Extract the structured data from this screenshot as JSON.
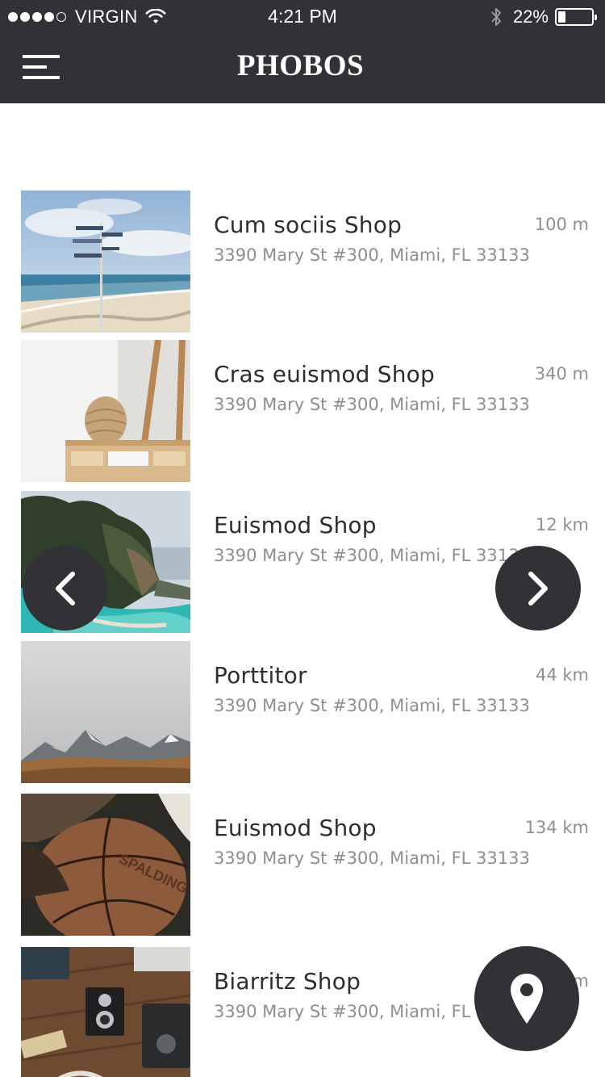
{
  "status_bar": {
    "carrier": "VIRGIN",
    "time": "4:21 PM",
    "battery_percent": "22%",
    "battery_level": 0.22,
    "signal_bars_filled": 4,
    "signal_bars_total": 5
  },
  "header": {
    "title": "PHOBOS",
    "menu_icon": "hamburger-menu-icon",
    "background": "#323236"
  },
  "shops": [
    {
      "name": "Cum sociis Shop",
      "address": "3390 Mary St #300, Miami, FL 33133",
      "distance": "100 m"
    },
    {
      "name": "Cras euismod Shop",
      "address": "3390 Mary St #300, Miami, FL 33133",
      "distance": "340 m"
    },
    {
      "name": "Euismod Shop",
      "address": "3390 Mary St #300, Miami, FL 33133",
      "distance": "12 km"
    },
    {
      "name": "Porttitor",
      "address": "3390 Mary St #300, Miami, FL 33133",
      "distance": "44 km"
    },
    {
      "name": "Euismod Shop",
      "address": "3390 Mary St #300, Miami, FL 33133",
      "distance": "134 km"
    },
    {
      "name": "Biarritz Shop",
      "address": "3390 Mary St #300, Miami, FL 33133",
      "distance": "km"
    }
  ],
  "controls": {
    "prev_icon": "chevron-left-icon",
    "next_icon": "chevron-right-icon",
    "locate_icon": "map-pin-icon"
  },
  "colors": {
    "dark": "#323236",
    "title_text": "#2e2e32",
    "secondary_text": "#8e8e93"
  }
}
